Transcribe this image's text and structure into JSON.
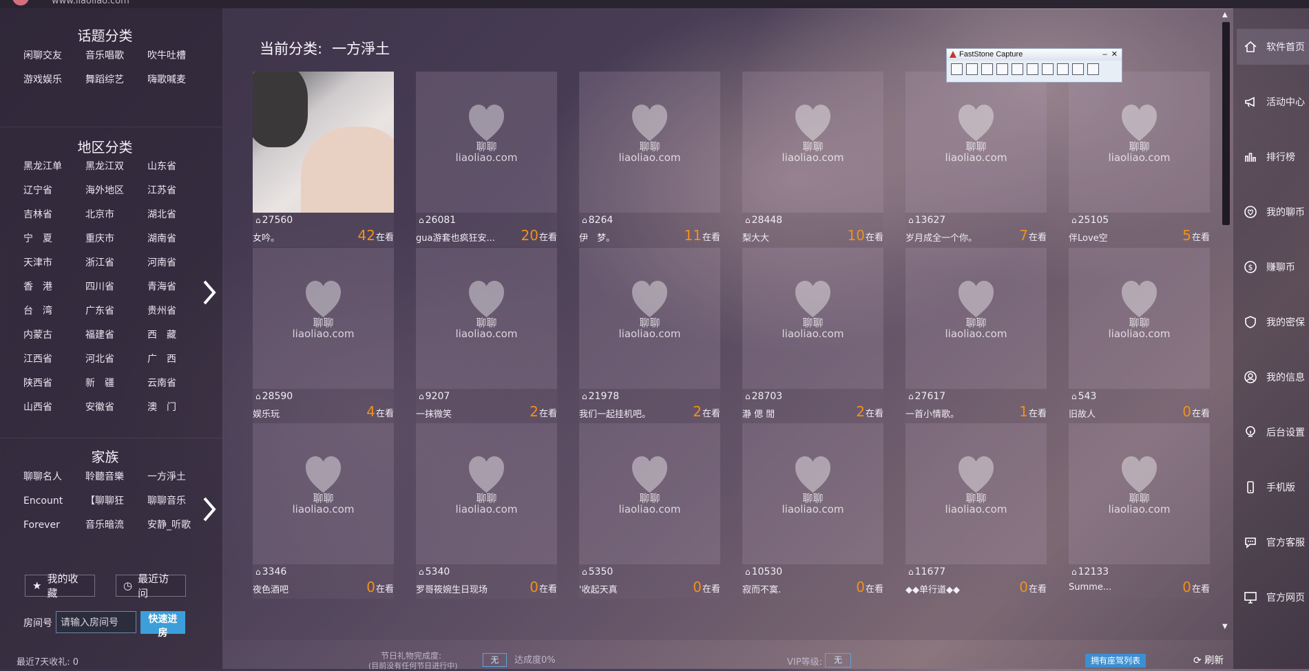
{
  "header": {
    "url": "www.liaoliao.com"
  },
  "sidebar": {
    "topic_title": "话题分类",
    "topics": [
      "闲聊交友",
      "音乐唱歌",
      "吹牛吐槽",
      "游戏娱乐",
      "舞蹈综艺",
      "嗨歌喊麦"
    ],
    "region_title": "地区分类",
    "regions": [
      "黑龙江单",
      "黑龙江双",
      "山东省",
      "辽宁省",
      "海外地区",
      "江苏省",
      "吉林省",
      "北京市",
      "湖北省",
      "宁　夏",
      "重庆市",
      "湖南省",
      "天津市",
      "浙江省",
      "河南省",
      "香　港",
      "四川省",
      "青海省",
      "台　湾",
      "广东省",
      "贵州省",
      "内蒙古",
      "福建省",
      "西　藏",
      "江西省",
      "河北省",
      "广　西",
      "陕西省",
      "新　疆",
      "云南省",
      "山西省",
      "安徽省",
      "澳　门"
    ],
    "family_title": "家族",
    "families": [
      "聊聊名人",
      "聆聽音樂",
      "一方淨土",
      "Encount",
      "【聊聊狂",
      "聊聊音乐",
      "Forever",
      "音乐暗流",
      "安静_听歌"
    ],
    "favorites_label": "我的收藏",
    "recent_label": "最近访问",
    "room_label": "房间号",
    "room_placeholder": "请输入房间号",
    "enter_label": "快速进房",
    "gift_stat": "最近7天收礼: 0"
  },
  "main": {
    "category_label": "当前分类:",
    "category_value": "一方淨土",
    "watermark_line1": "聊聊",
    "watermark_line2": "liaoliao.com",
    "watching_suffix": "在看",
    "rooms": [
      {
        "id": "27560",
        "name": "女吟。",
        "count": "42"
      },
      {
        "id": "26081",
        "name": "gua游套也疯狂安...",
        "count": "20"
      },
      {
        "id": "8264",
        "name": "伊　梦。",
        "count": "11"
      },
      {
        "id": "28448",
        "name": "梨大大",
        "count": "10"
      },
      {
        "id": "13627",
        "name": "岁月成全一个你。",
        "count": "7"
      },
      {
        "id": "25105",
        "name": "伴Love空",
        "count": "5"
      },
      {
        "id": "28590",
        "name": "娱乐玩",
        "count": "4"
      },
      {
        "id": "9207",
        "name": "一抹微笑",
        "count": "2"
      },
      {
        "id": "21978",
        "name": "我们一起挂机吧。",
        "count": "2"
      },
      {
        "id": "28703",
        "name": "瀞 偲 閒",
        "count": "2"
      },
      {
        "id": "27617",
        "name": "一首小情歌。",
        "count": "1"
      },
      {
        "id": "543",
        "name": "旧故人",
        "count": "0"
      },
      {
        "id": "3346",
        "name": "夜色酒吧",
        "count": "0"
      },
      {
        "id": "5340",
        "name": "罗哥筱婉生日现场",
        "count": "0"
      },
      {
        "id": "5350",
        "name": "'收起天真",
        "count": "0"
      },
      {
        "id": "10530",
        "name": "寂而不寞.",
        "count": "0"
      },
      {
        "id": "11677",
        "name": "◆◆单行道◆◆",
        "count": "0"
      },
      {
        "id": "12133",
        "name": "Summe...",
        "count": "0"
      }
    ]
  },
  "faststone": {
    "title": "FastStone Capture"
  },
  "right_nav": [
    {
      "label": "软件首页",
      "icon": "home-icon"
    },
    {
      "label": "活动中心",
      "icon": "megaphone-icon"
    },
    {
      "label": "排行榜",
      "icon": "bar-chart-icon"
    },
    {
      "label": "我的聊币",
      "icon": "coin-heart-icon"
    },
    {
      "label": "赚聊币",
      "icon": "dollar-coin-icon"
    },
    {
      "label": "我的密保",
      "icon": "shield-icon"
    },
    {
      "label": "我的信息",
      "icon": "user-icon"
    },
    {
      "label": "后台设置",
      "icon": "lock-settings-icon"
    },
    {
      "label": "手机版",
      "icon": "phone-icon"
    },
    {
      "label": "官方客服",
      "icon": "chat-icon"
    },
    {
      "label": "官方网页",
      "icon": "monitor-icon"
    }
  ],
  "bottom": {
    "festival_label": "节日礼物完成度:",
    "festival_sub": "(目前没有任何节日进行中)",
    "festival_value": "无",
    "progress_label": "达成度0%",
    "vip_label": "VIP等级:",
    "vip_value": "无",
    "seat_button": "拥有座驾列表",
    "refresh_label": "刷新"
  },
  "colors": {
    "accent": "#3c9fd9",
    "count_orange": "#f2901c"
  }
}
